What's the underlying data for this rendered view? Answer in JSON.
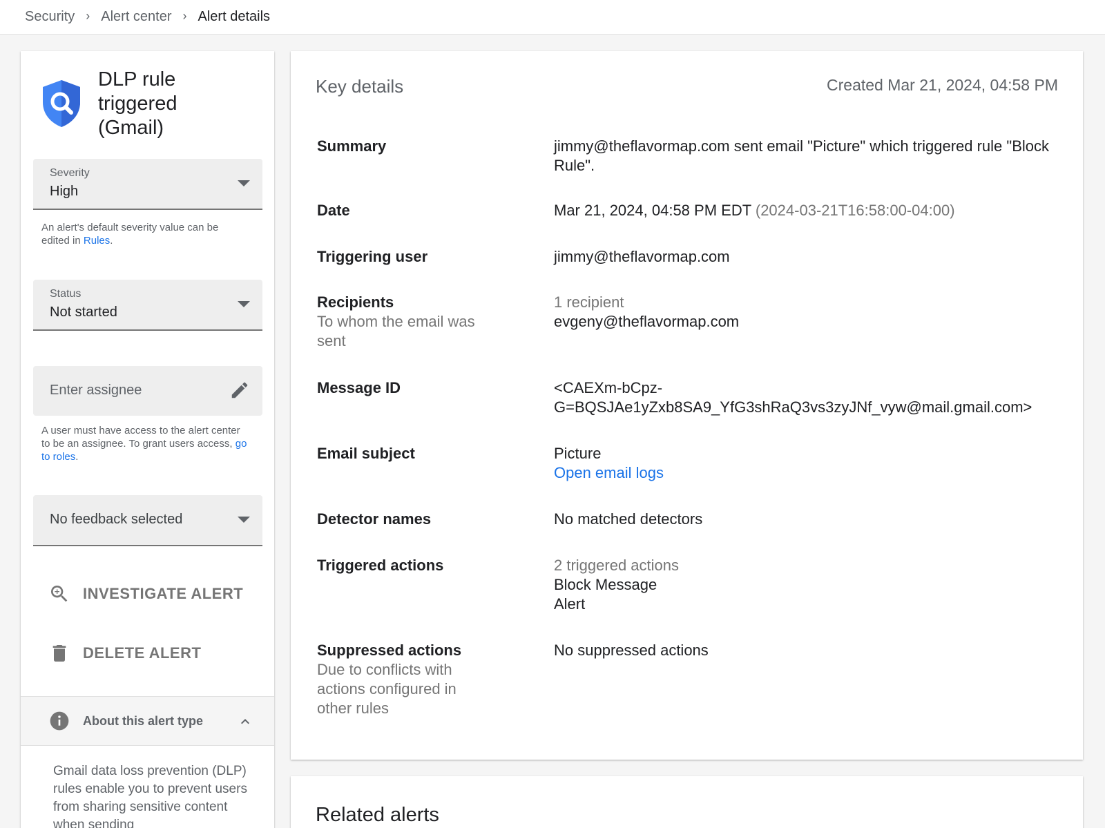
{
  "breadcrumb": {
    "items": [
      "Security",
      "Alert center",
      "Alert details"
    ]
  },
  "alert": {
    "title": "DLP rule triggered (Gmail)",
    "icon": "shield-search-icon",
    "brand_color": "#4285f4"
  },
  "severity": {
    "label": "Severity",
    "value": "High",
    "helper_prefix": "An alert's default severity value can be edited in ",
    "helper_link": "Rules",
    "helper_suffix": "."
  },
  "status": {
    "label": "Status",
    "value": "Not started"
  },
  "assignee": {
    "placeholder": "Enter assignee",
    "helper_prefix": "A user must have access to the alert center to be an assignee. To grant users access, ",
    "helper_link": "go to roles",
    "helper_suffix": "."
  },
  "feedback": {
    "value": "No feedback selected"
  },
  "actions": {
    "investigate": "INVESTIGATE ALERT",
    "delete": "DELETE ALERT"
  },
  "about": {
    "label": "About this alert type",
    "text": "Gmail data loss prevention (DLP) rules enable you to prevent users from sharing sensitive content when sending"
  },
  "key_details": {
    "title": "Key details",
    "created": "Created Mar 21, 2024, 04:58 PM",
    "summary": {
      "label": "Summary",
      "value": "jimmy@theflavormap.com sent email \"Picture\" which triggered rule \"Block Rule\"."
    },
    "date": {
      "label": "Date",
      "value": "Mar 21, 2024, 04:58 PM EDT",
      "iso": "(2024-03-21T16:58:00-04:00)"
    },
    "triggering_user": {
      "label": "Triggering user",
      "value": "jimmy@theflavormap.com"
    },
    "recipients": {
      "label": "Recipients",
      "sublabel": "To whom the email was sent",
      "count": "1 recipient",
      "value": "evgeny@theflavormap.com"
    },
    "message_id": {
      "label": "Message ID",
      "line1": "<CAEXm-bCpz-",
      "line2": "G=BQSJAe1yZxb8SA9_YfG3shRaQ3vs3zyJNf_vyw@mail.gmail.com>"
    },
    "email_subject": {
      "label": "Email subject",
      "value": "Picture",
      "link": "Open email logs"
    },
    "detector_names": {
      "label": "Detector names",
      "value": "No matched detectors"
    },
    "triggered_actions": {
      "label": "Triggered actions",
      "count": "2 triggered actions",
      "items": [
        "Block Message",
        "Alert"
      ]
    },
    "suppressed_actions": {
      "label": "Suppressed actions",
      "sublabel": "Due to conflicts with actions configured in other rules",
      "value": "No suppressed actions"
    }
  },
  "related": {
    "title": "Related alerts"
  }
}
